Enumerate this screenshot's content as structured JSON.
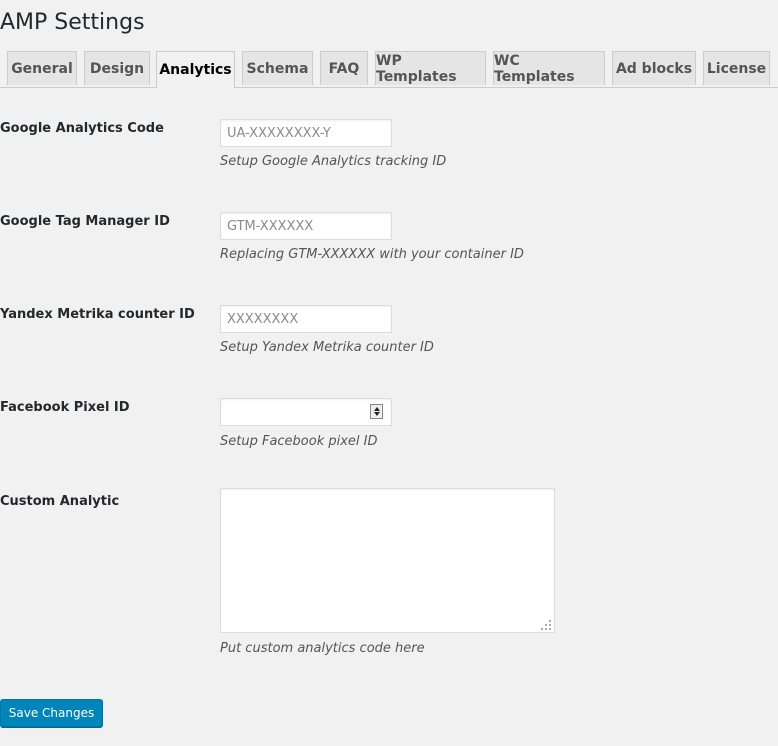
{
  "page_title": "AMP Settings",
  "tabs": [
    {
      "label": "General",
      "active": false
    },
    {
      "label": "Design",
      "active": false
    },
    {
      "label": "Analytics",
      "active": true
    },
    {
      "label": "Schema",
      "active": false
    },
    {
      "label": "FAQ",
      "active": false
    },
    {
      "label": "WP Templates",
      "active": false
    },
    {
      "label": "WC Templates",
      "active": false
    },
    {
      "label": "Ad blocks",
      "active": false
    },
    {
      "label": "License",
      "active": false
    }
  ],
  "fields": {
    "google_analytics": {
      "label": "Google Analytics Code",
      "placeholder": "UA-XXXXXXXX-Y",
      "value": "",
      "description": "Setup Google Analytics tracking ID"
    },
    "google_tag_manager": {
      "label": "Google Tag Manager ID",
      "placeholder": "GTM-XXXXXX",
      "value": "",
      "description": "Replacing GTM-XXXXXX with your container ID"
    },
    "yandex_metrika": {
      "label": "Yandex Metrika counter ID",
      "placeholder": "XXXXXXXX",
      "value": "",
      "description": "Setup Yandex Metrika counter ID"
    },
    "facebook_pixel": {
      "label": "Facebook Pixel ID",
      "value": "",
      "description": "Setup Facebook pixel ID"
    },
    "custom_analytic": {
      "label": "Custom Analytic",
      "value": "",
      "description": "Put custom analytics code here"
    }
  },
  "save_button": "Save Changes",
  "colors": {
    "primary_button": "#0085ba",
    "background": "#f1f1f1"
  }
}
